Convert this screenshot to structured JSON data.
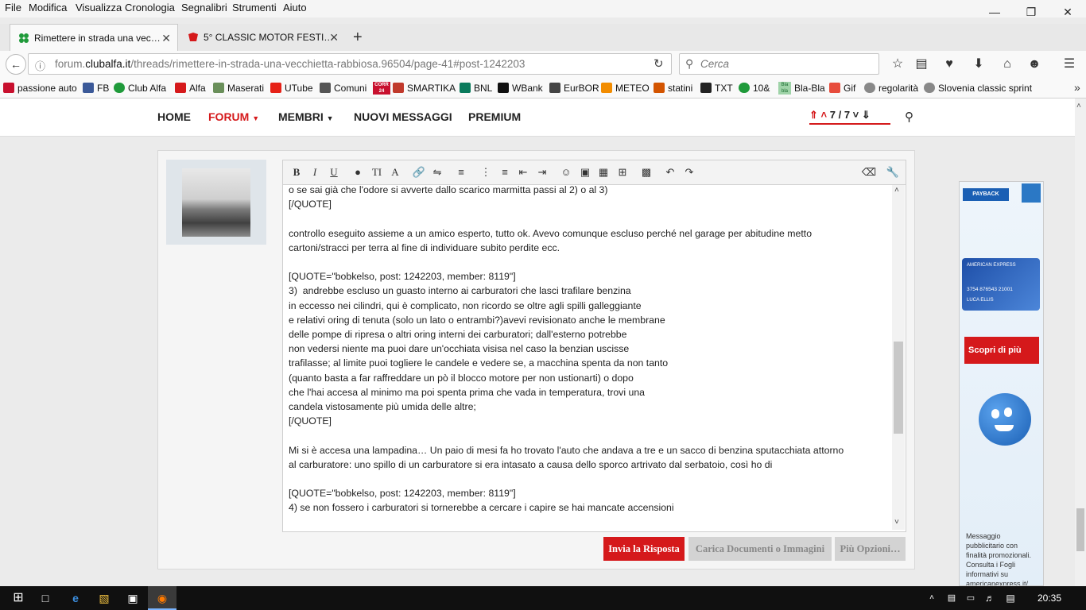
{
  "menubar": {
    "items": [
      "File",
      "Modifica",
      "Visualizza",
      "Cronologia",
      "Segnalibri",
      "Strumenti",
      "Aiuto"
    ]
  },
  "tabs": [
    {
      "label": "Rimettere in strada una vec…",
      "icon": "clover-icon"
    },
    {
      "label": "5° CLASSIC MOTOR FESTI…",
      "icon": "cross-logo-icon"
    }
  ],
  "urlbar": {
    "prefix": "forum.",
    "domain": "clubalfa.it",
    "path": "/threads/rimettere-in-strada-una-vecchietta-rabbiosa.96504/page-41#post-1242203"
  },
  "search": {
    "placeholder": "Cerca"
  },
  "bookmarks": [
    "passione auto",
    "FB",
    "Club Alfa",
    "Alfa",
    "Maserati",
    "UTube",
    "Comuni",
    "SMARTIKA",
    "BNL",
    "WBank",
    "EurBOR",
    "METEO",
    "statini",
    "TXT",
    "10&",
    "Bla-Bla",
    "Gif",
    "regolarità",
    "Slovenia classic sprint"
  ],
  "bookmark_icon_badges": {
    "comuni": "CORR 24",
    "blabla": "Bla bla"
  },
  "site_nav": {
    "home": "HOME",
    "forum": "FORUM",
    "membri": "MEMBRI",
    "nuovi": "NUOVI MESSAGGI",
    "premium": "PREMIUM",
    "pager": "7 / 7"
  },
  "editor": {
    "lines": [
      "o se sai già che l'odore si avverte dallo scarico marmitta passi al 2) o al 3)",
      "[/QUOTE]",
      "",
      "controllo eseguito assieme a un amico esperto, tutto ok. Avevo comunque escluso perché nel garage per abitudine metto",
      "cartoni/stracci per terra al fine di individuare subito perdite ecc.",
      "",
      "[QUOTE=\"bobkelso, post: 1242203, member: 8119\"]",
      "3)  andrebbe escluso un guasto interno ai carburatori che lasci trafilare benzina",
      "in eccesso nei cilindri, qui è complicato, non ricordo se oltre agli spilli galleggiante",
      "e relativi oring di tenuta (solo un lato o entrambi?)avevi revisionato anche le membrane",
      "delle pompe di ripresa o altri oring interni dei carburatori; dall'esterno potrebbe",
      "non vedersi niente ma puoi dare un'occhiata visisa nel caso la benzian uscisse",
      "trafilasse; al limite puoi togliere le candele e vedere se, a macchina spenta da non tanto",
      "(quanto basta a far raffreddare un pò il blocco motore per non ustionarti) o dopo",
      "che l'hai accesa al minimo ma poi spenta prima che vada in temperatura, trovi una",
      "candela vistosamente più umida delle altre;",
      "[/QUOTE]",
      "",
      "Mi si è accesa una lampadina… Un paio di mesi fa ho trovato l'auto che andava a tre e un sacco di benzina sputacchiata attorno",
      "al carburatore: uno spillo di un carburatore si era intasato a causa dello sporco artrivato dal serbatoio, così ho di",
      "",
      "[QUOTE=\"bobkelso, post: 1242203, member: 8119\"]",
      "4) se non fossero i carburatori si tornerebbe a cercare i capire se hai mancate accensioni"
    ]
  },
  "buttons": {
    "reply": "Invia la Risposta",
    "upload": "Carica Documenti o Immagini",
    "more": "Più Opzioni…"
  },
  "ad": {
    "cta": "Scopri di più",
    "payback": "PAYBACK",
    "card": "AMERICAN EXPRESS",
    "card_number": "3754 876543 21001",
    "card_name": "LUCA ELLIS",
    "disclaimer": "Messaggio pubblicitario con finalità promozionali. Consulta i Fogli informativi su americanexpress.it/"
  },
  "taskbar": {
    "time": "20:35"
  },
  "colors": {
    "accent_red": "#d5191b",
    "button_gray": "#d3d3d3",
    "link_blue": "#1a5fb4"
  }
}
